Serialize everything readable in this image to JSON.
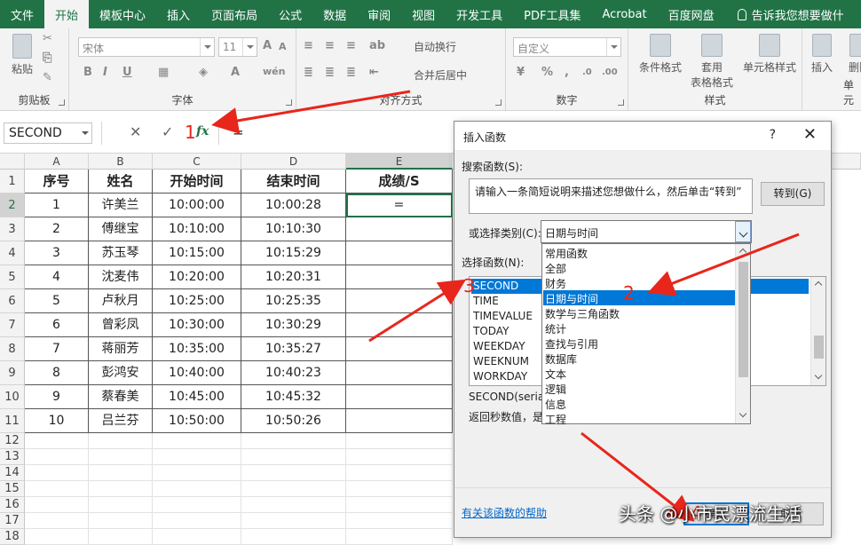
{
  "tabs": [
    "文件",
    "开始",
    "模板中心",
    "插入",
    "页面布局",
    "公式",
    "数据",
    "审阅",
    "视图",
    "开发工具",
    "PDF工具集",
    "Acrobat",
    "百度网盘"
  ],
  "active_tab": "开始",
  "tell_me": "告诉我您想要做什",
  "ribbon": {
    "clipboard": {
      "label": "剪贴板",
      "paste": "粘贴"
    },
    "font": {
      "label": "字体",
      "font_name": "宋体",
      "font_size": "11"
    },
    "alignment": {
      "label": "对齐方式",
      "wrap": "自动换行",
      "merge": "合并后居中"
    },
    "number": {
      "label": "数字",
      "format": "自定义"
    },
    "styles": {
      "label": "样式",
      "cond": "条件格式",
      "table_line1": "套用",
      "table_line2": "表格格式",
      "cell_styles": "单元格样式"
    },
    "cells": {
      "label": "单元",
      "insert": "插入",
      "delete": "删除"
    }
  },
  "formula_bar": {
    "name_box": "SECOND",
    "content": "="
  },
  "sheet": {
    "columns": [
      "A",
      "B",
      "C",
      "D",
      "E"
    ],
    "row_numbers": [
      "1",
      "2",
      "3",
      "4",
      "5",
      "6",
      "7",
      "8",
      "9",
      "10",
      "11",
      "12",
      "13",
      "14",
      "15",
      "16",
      "17",
      "18"
    ],
    "headers": [
      "序号",
      "姓名",
      "开始时间",
      "结束时间",
      "成绩/S"
    ],
    "rows": [
      [
        "1",
        "许美兰",
        "10:00:00",
        "10:00:28",
        "="
      ],
      [
        "2",
        "傅继宝",
        "10:10:00",
        "10:10:30",
        ""
      ],
      [
        "3",
        "苏玉琴",
        "10:15:00",
        "10:15:29",
        ""
      ],
      [
        "4",
        "沈麦伟",
        "10:20:00",
        "10:20:31",
        ""
      ],
      [
        "5",
        "卢秋月",
        "10:25:00",
        "10:25:35",
        ""
      ],
      [
        "6",
        "曾彩凤",
        "10:30:00",
        "10:30:29",
        ""
      ],
      [
        "7",
        "蒋丽芳",
        "10:35:00",
        "10:35:27",
        ""
      ],
      [
        "8",
        "彭鸿安",
        "10:40:00",
        "10:40:23",
        ""
      ],
      [
        "9",
        "蔡春美",
        "10:45:00",
        "10:45:32",
        ""
      ],
      [
        "10",
        "吕兰芬",
        "10:50:00",
        "10:50:26",
        ""
      ]
    ]
  },
  "dialog": {
    "title": "插入函数",
    "help": "?",
    "close": "✕",
    "search_label": "搜索函数(S):",
    "search_text": "请输入一条简短说明来描述您想做什么，然后单击“转到”",
    "go_button": "转到(G)",
    "category_label": "或选择类别(C):",
    "category_value": "日期与时间",
    "select_label": "选择函数(N):",
    "functions": [
      "SECOND",
      "TIME",
      "TIMEVALUE",
      "TODAY",
      "WEEKDAY",
      "WEEKNUM",
      "WORKDAY"
    ],
    "selected_function": "SECOND",
    "syntax": "SECOND(seria",
    "description": "返回秒数值，是",
    "help_link": "有关该函数的帮助",
    "ok": "确定",
    "cancel": "取消"
  },
  "category_list": [
    "常用函数",
    "全部",
    "财务",
    "日期与时间",
    "数学与三角函数",
    "统计",
    "查找与引用",
    "数据库",
    "文本",
    "逻辑",
    "信息",
    "工程"
  ],
  "category_selected_index": 3,
  "annotations": [
    "1",
    "2",
    "3",
    "4"
  ],
  "watermark": "头条 @小市民漂流生活",
  "colors": {
    "excel_green": "#217346",
    "selection_blue": "#0078d7",
    "annotation_red": "#e8261c"
  }
}
